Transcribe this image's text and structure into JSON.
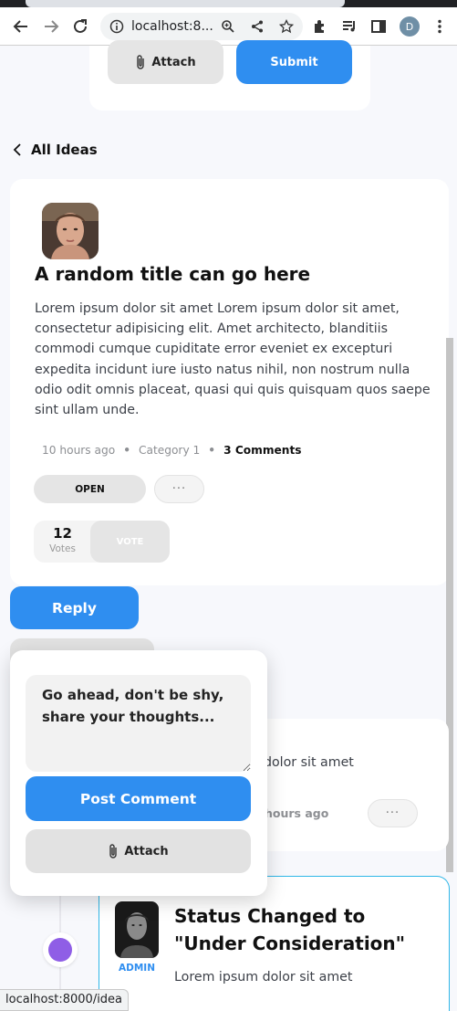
{
  "browser": {
    "url": "localhost:8...",
    "profile_initial": "D",
    "status_url": "localhost:8000/idea"
  },
  "top_form": {
    "attach_label": "Attach",
    "submit_label": "Submit"
  },
  "back_link": "All Ideas",
  "idea": {
    "title": "A random title can go here",
    "body": "Lorem ipsum dolor sit amet Lorem ipsum dolor sit amet, consectetur adipisicing elit. Amet architecto, blanditiis commodi cumque cupiditate error eveniet ex excepturi expedita incidunt iure iusto natus nihil, non nostrum nulla odio odit omnis placeat, quasi qui quis quisquam quos saepe sint ullam unde.",
    "time": "10 hours ago",
    "category": "Category 1",
    "comments": "3 Comments",
    "status": "OPEN",
    "more": "···",
    "votes_count": "12",
    "votes_label": "Votes",
    "vote_button": "VOTE"
  },
  "reply": {
    "button_label": "Reply",
    "placeholder": "Go ahead, don't be shy, share your thoughts...",
    "post_label": "Post Comment",
    "attach_label": "Attach"
  },
  "comment": {
    "text_fragment": "dolor sit amet",
    "time_fragment": "hours ago",
    "more": "···"
  },
  "status_update": {
    "title": "Status Changed to \"Under Consideration\"",
    "role": "ADMIN",
    "body": "Lorem ipsum dolor sit amet"
  },
  "colors": {
    "primary": "#2f8ef0",
    "timeline_dot": "#8f5ee6",
    "status_border": "#2fb7e8"
  }
}
